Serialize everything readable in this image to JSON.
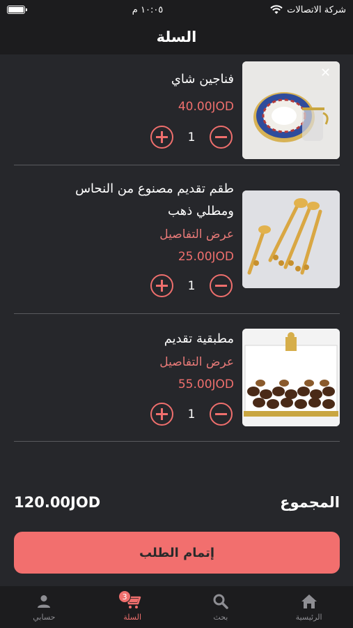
{
  "status_bar": {
    "carrier": "شركة الاتصالات",
    "time": "١٠:٠٥ م",
    "battery_level": 1.0
  },
  "header": {
    "title": "السلة"
  },
  "items": [
    {
      "name_line1": "فناجين شاي",
      "name_line2": "",
      "details_link": "",
      "price": "40.00JOD",
      "quantity": "1"
    },
    {
      "name_line1": "طقم تقديم مصنوع من النحاس",
      "name_line2": "ومطلي ذهب",
      "details_link": "عرض التفاصيل",
      "price": "25.00JOD",
      "quantity": "1"
    },
    {
      "name_line1": "مطبقية تقديم",
      "name_line2": "",
      "details_link": "عرض التفاصيل",
      "price": "55.00JOD",
      "quantity": "1"
    }
  ],
  "total": {
    "label": "المجموع",
    "amount": "120.00JOD"
  },
  "checkout": {
    "label": "إتمام الطلب"
  },
  "tabbar": {
    "tabs": [
      {
        "label": "حسابي",
        "icon": "person-icon"
      },
      {
        "label": "السلة",
        "icon": "cart-icon",
        "badge": "3",
        "active": true
      },
      {
        "label": "بحث",
        "icon": "search-icon"
      },
      {
        "label": "الرئيسية",
        "icon": "home-icon"
      }
    ]
  },
  "colors": {
    "accent": "#ef6f6d",
    "background": "#26272b",
    "bar": "#1c1c1e"
  }
}
